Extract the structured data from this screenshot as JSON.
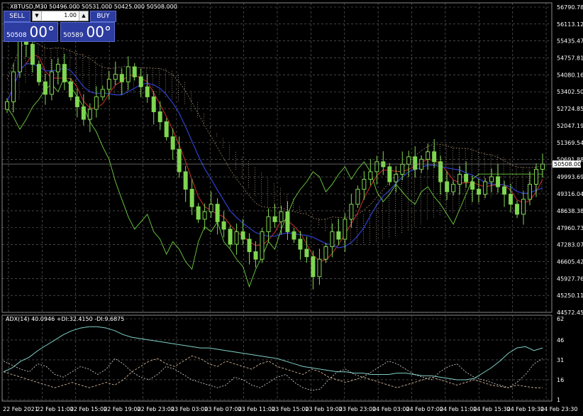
{
  "header": {
    "symbol_line": "XBTUSD,M30  50496.000 50531.000 50425.000 50508.000",
    "adx_line": "ADX(14) 40.0946 +DI:32.4150 -DI:9.6875"
  },
  "trade_panel": {
    "sell_label": "SELL",
    "buy_label": "BUY",
    "lot_value": "1.00",
    "sell_price_small": "50508",
    "sell_price_big": "00°",
    "buy_price_small": "50589",
    "buy_price_big": "00°"
  },
  "colors": {
    "background": "#000000",
    "grid": "#6f6f6f",
    "candle": "#7fd650",
    "panel_button": "#2d3ca0",
    "price_marker_bg": "#ffffff"
  },
  "chart_data": [
    {
      "type": "candlestick",
      "title": "XBTUSD,M30",
      "price_label": "50508.000",
      "y_ticks": [
        "56790.780",
        "56113.125",
        "55435.470",
        "54757.815",
        "54080.160",
        "53402.505",
        "52724.850",
        "52047.195",
        "51369.540",
        "50691.885",
        "49993.695",
        "49316.040",
        "48638.385",
        "47960.730",
        "47283.075",
        "46605.420",
        "45927.765",
        "45250.110",
        "44572.455"
      ],
      "x_ticks": [
        "22 Feb 2021",
        "22 Feb 11:00",
        "22 Feb 15:00",
        "22 Feb 19:00",
        "22 Feb 23:00",
        "23 Feb 03:00",
        "23 Feb 07:00",
        "23 Feb 11:00",
        "23 Feb 15:00",
        "23 Feb 19:00",
        "23 Feb 23:00",
        "24 Feb 03:00",
        "24 Feb 07:00",
        "24 Feb 11:00",
        "24 Feb 15:30",
        "24 Feb 19:30",
        "24 Feb 23:30"
      ],
      "ylim": [
        44572.455,
        56790.78
      ],
      "close_values": [
        53000,
        54200,
        55600,
        55300,
        54500,
        53800,
        53300,
        54200,
        54500,
        53800,
        53200,
        52800,
        52300,
        52700,
        53200,
        53500,
        53900,
        54100,
        53800,
        54400,
        54000,
        53600,
        53200,
        52600,
        52200,
        51600,
        51100,
        50200,
        49500,
        48800,
        48300,
        48600,
        48900,
        48200,
        47900,
        47300,
        47800,
        47500,
        47000,
        46700,
        47800,
        48400,
        48200,
        48600,
        47800,
        47500,
        47100,
        46800,
        46000,
        46700,
        47200,
        47800,
        47500,
        48300,
        48900,
        49500,
        49900,
        50200,
        50600,
        50400,
        49800,
        50100,
        50500,
        50800,
        50300,
        50700,
        51000,
        50600,
        49800,
        49400,
        49700,
        50100,
        49800,
        49500,
        49300,
        49800,
        50000,
        49600,
        49300,
        48900,
        48500,
        49100,
        49700,
        50300,
        50508
      ],
      "overlays": [
        "ichimoku-cloud",
        "moving-average-red",
        "moving-average-blue",
        "moving-average-green"
      ]
    },
    {
      "type": "line",
      "title": "ADX(14)",
      "y_ticks": [
        "62",
        "46",
        "31",
        "16",
        "1"
      ],
      "ylim": [
        1,
        62
      ],
      "series": [
        {
          "name": "ADX",
          "values": [
            22,
            25,
            30,
            33,
            38,
            42,
            46,
            50,
            53,
            55,
            56,
            56,
            55,
            53,
            50,
            48,
            47,
            46,
            45,
            44,
            43,
            42,
            41,
            40,
            40,
            39,
            38,
            37,
            36,
            35,
            34,
            33,
            32,
            30,
            28,
            26,
            25,
            24,
            23,
            22,
            22,
            21,
            21,
            20,
            20,
            20,
            21,
            21,
            20,
            19,
            19,
            18,
            17,
            16,
            16,
            17,
            21,
            25,
            30,
            36,
            40,
            41,
            38,
            40
          ]
        },
        {
          "name": "+DI",
          "values": [
            30,
            27,
            24,
            22,
            28,
            26,
            20,
            18,
            22,
            26,
            24,
            20,
            24,
            32,
            28,
            22,
            18,
            16,
            20,
            26,
            24,
            20,
            16,
            14,
            12,
            10,
            12,
            18,
            16,
            12,
            10,
            14,
            18,
            20,
            14,
            10,
            8,
            9,
            16,
            22,
            24,
            20,
            18,
            22,
            26,
            30,
            28,
            24,
            20,
            18,
            16,
            22,
            26,
            28,
            22,
            18,
            16,
            14,
            12,
            10,
            14,
            20,
            28,
            32
          ]
        },
        {
          "name": "-DI",
          "values": [
            22,
            20,
            18,
            16,
            14,
            12,
            10,
            12,
            14,
            12,
            10,
            12,
            14,
            12,
            16,
            22,
            26,
            30,
            32,
            28,
            26,
            30,
            34,
            32,
            28,
            26,
            30,
            28,
            26,
            24,
            28,
            30,
            26,
            24,
            22,
            20,
            24,
            22,
            18,
            16,
            14,
            16,
            18,
            16,
            14,
            12,
            10,
            12,
            14,
            16,
            18,
            16,
            14,
            12,
            14,
            16,
            14,
            12,
            11,
            10,
            12,
            11,
            10,
            10
          ]
        }
      ]
    }
  ]
}
